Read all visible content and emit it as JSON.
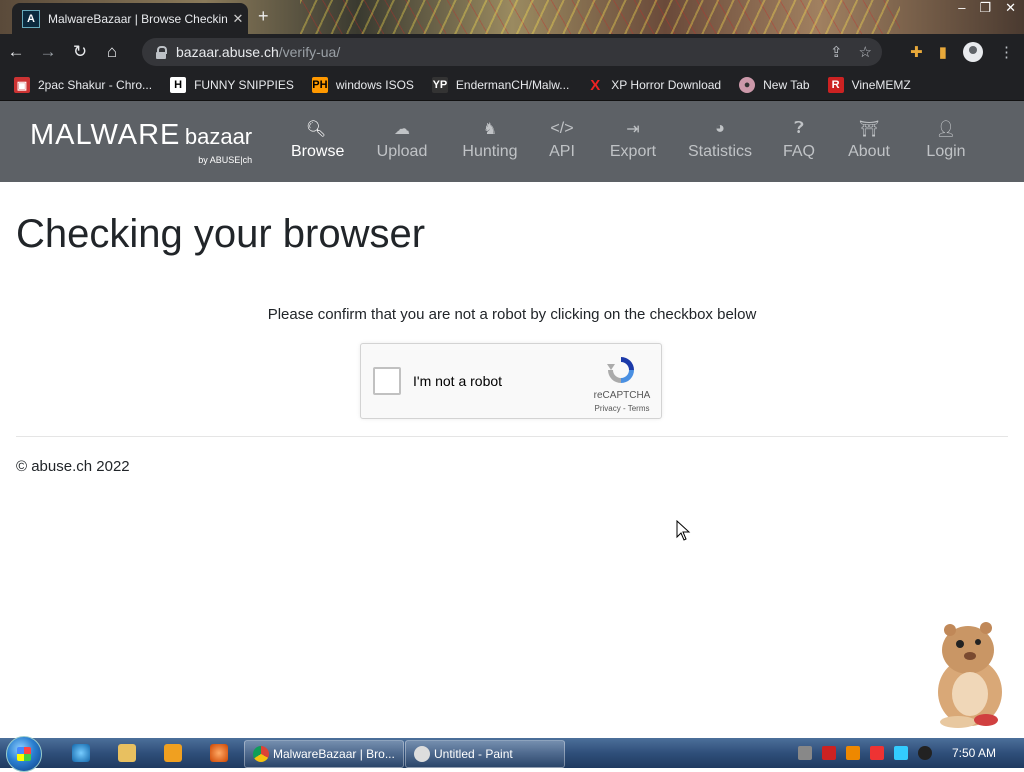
{
  "browser": {
    "tab_title": "MalwareBazaar | Browse Checkin",
    "url_host": "bazaar.abuse.ch",
    "url_path": "/verify-ua/"
  },
  "bookmarks": [
    {
      "label": "2pac Shakur - Chro...",
      "icon": "sticker-icon"
    },
    {
      "label": "FUNNY SNIPPIES",
      "icon": "h-icon"
    },
    {
      "label": "windows ISOS",
      "icon": "ph-icon"
    },
    {
      "label": "EndermanCH/Malw...",
      "icon": "yp-icon"
    },
    {
      "label": "XP Horror Download",
      "icon": "x-icon"
    },
    {
      "label": "New Tab",
      "icon": "globe-icon"
    },
    {
      "label": "VineMEMZ",
      "icon": "r-icon"
    }
  ],
  "site": {
    "logo_main": "MALWARE",
    "logo_sub": "bazaar",
    "logo_by": "by ABUSE|ch",
    "nav": [
      {
        "label": "Browse",
        "icon": "search-icon",
        "active": true
      },
      {
        "label": "Upload",
        "icon": "cloud-upload-icon"
      },
      {
        "label": "Hunting",
        "icon": "hunting-icon"
      },
      {
        "label": "API",
        "icon": "code-icon"
      },
      {
        "label": "Export",
        "icon": "export-icon"
      },
      {
        "label": "Statistics",
        "icon": "pie-chart-icon"
      },
      {
        "label": "FAQ",
        "icon": "question-icon"
      },
      {
        "label": "About",
        "icon": "about-icon"
      },
      {
        "label": "Login",
        "icon": "user-icon"
      }
    ]
  },
  "content": {
    "heading": "Checking your browser",
    "instruction": "Please confirm that you are not a robot by clicking on the checkbox below",
    "captcha_label": "I'm not a robot",
    "captcha_brand": "reCAPTCHA",
    "captcha_links": "Privacy - Terms",
    "footer": "© abuse.ch 2022"
  },
  "taskbar": {
    "items": [
      {
        "label": "MalwareBazaar | Bro..."
      },
      {
        "label": "Untitled - Paint"
      }
    ],
    "clock": "7:50 AM"
  }
}
